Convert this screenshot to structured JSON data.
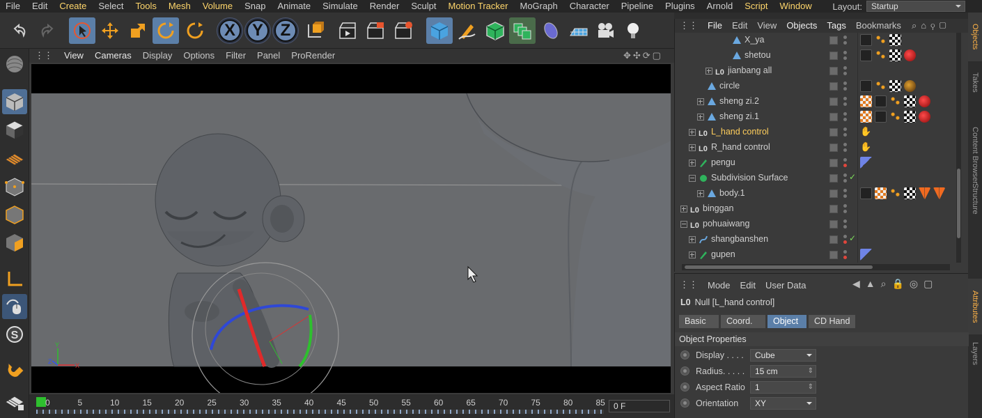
{
  "menubar": {
    "items": [
      "File",
      "Edit",
      "Create",
      "Select",
      "Tools",
      "Mesh",
      "Volume",
      "Snap",
      "Animate",
      "Simulate",
      "Render",
      "Sculpt",
      "Motion Tracker",
      "MoGraph",
      "Character",
      "Pipeline",
      "Plugins",
      "Arnold",
      "Script",
      "Window"
    ],
    "layout_label": "Layout:",
    "layout_value": "Startup"
  },
  "toolbar": {
    "icons": [
      "undo-icon",
      "redo-icon",
      "live-selection-icon",
      "move-icon",
      "scale-icon",
      "rotate-icon",
      "recent-tool-icon",
      "x-axis-icon",
      "y-axis-icon",
      "z-axis-icon",
      "coordinate-system-icon",
      "render-view-icon",
      "render-picture-viewer-icon",
      "render-settings-icon",
      "cube-icon",
      "pen-icon",
      "subdivision-icon",
      "array-icon",
      "deformer-icon",
      "floor-icon",
      "camera-icon",
      "light-icon"
    ],
    "axis_labels": [
      "X",
      "Y",
      "Z"
    ]
  },
  "viewport": {
    "menu": [
      "View",
      "Cameras",
      "Display",
      "Options",
      "Filter",
      "Panel",
      "ProRender"
    ],
    "axis_labels": {
      "x": "X",
      "y": "Y",
      "z": "Z"
    }
  },
  "timeline": {
    "ticks": [
      "0",
      "5",
      "10",
      "15",
      "20",
      "25",
      "30",
      "35",
      "40",
      "45",
      "50",
      "55",
      "60",
      "65",
      "70",
      "75",
      "80",
      "85"
    ],
    "current_frame": "0 F"
  },
  "objects": {
    "menu": [
      "File",
      "Edit",
      "View",
      "Objects",
      "Tags",
      "Bookmarks"
    ],
    "rows": [
      {
        "name": "X_ya",
        "indent": 5,
        "icon": "joint",
        "expander": "none",
        "tags": [
          "dark",
          "dots",
          "checker"
        ]
      },
      {
        "name": "shetou",
        "indent": 5,
        "icon": "joint",
        "expander": "none",
        "tags": [
          "dark",
          "dots",
          "checker",
          "red-ball"
        ]
      },
      {
        "name": "jianbang all",
        "indent": 3,
        "icon": "null",
        "expander": "plus",
        "tags": []
      },
      {
        "name": "circle",
        "indent": 2,
        "icon": "joint",
        "expander": "none",
        "tags": [
          "dark",
          "dots",
          "checker",
          "brown-ball"
        ]
      },
      {
        "name": "sheng zi.2",
        "indent": 2,
        "icon": "joint",
        "expander": "plus",
        "tags": [
          "orange-checker",
          "dark",
          "dots",
          "checker",
          "red-ball"
        ]
      },
      {
        "name": "sheng zi.1",
        "indent": 2,
        "icon": "joint",
        "expander": "plus",
        "tags": [
          "orange-checker",
          "dark",
          "dots",
          "checker",
          "red-ball"
        ]
      },
      {
        "name": "L_hand control",
        "indent": 1,
        "icon": "null",
        "expander": "plus",
        "highlighted": true,
        "tags": [
          "hand"
        ]
      },
      {
        "name": "R_hand control",
        "indent": 1,
        "icon": "null",
        "expander": "plus",
        "tags": [
          "hand"
        ]
      },
      {
        "name": "pengu",
        "indent": 1,
        "icon": "pen",
        "expander": "plus",
        "dotsRed": true,
        "tags": [
          "vertex-map"
        ]
      },
      {
        "name": "Subdivision Surface",
        "indent": 1,
        "icon": "subdiv",
        "expander": "minus",
        "check": true,
        "tags": []
      },
      {
        "name": "body.1",
        "indent": 2,
        "icon": "joint",
        "expander": "plus",
        "tags": [
          "dark",
          "orange-checker",
          "dots",
          "checker",
          "orange-tri",
          "orange-tri"
        ]
      },
      {
        "name": "binggan",
        "indent": 0,
        "icon": "null",
        "expander": "plus",
        "tags": []
      },
      {
        "name": "pohuaiwang",
        "indent": 0,
        "icon": "null",
        "expander": "minus",
        "tags": []
      },
      {
        "name": "shangbanshen",
        "indent": 1,
        "icon": "spline",
        "expander": "plus",
        "dotsRed": true,
        "check": true,
        "tags": []
      },
      {
        "name": "gupen",
        "indent": 1,
        "icon": "pen",
        "expander": "plus",
        "dotsRed": true,
        "tags": [
          "vertex-map"
        ]
      }
    ]
  },
  "sidetabs": [
    "Objects",
    "Takes",
    "Content Browser",
    "Structure",
    "Attributes",
    "Layers"
  ],
  "attributes": {
    "menu": [
      "Mode",
      "Edit",
      "User Data"
    ],
    "title": "Null [L_hand control]",
    "tabs": [
      "Basic",
      "Coord.",
      "Object",
      "CD Hand"
    ],
    "active_tab": "Object",
    "section": "Object Properties",
    "props": [
      {
        "label": "Display . . . .",
        "value": "Cube",
        "kind": "dd"
      },
      {
        "label": "Radius. . . . .",
        "value": "15 cm",
        "kind": "spin"
      },
      {
        "label": "Aspect Ratio",
        "value": "1",
        "kind": "spin"
      },
      {
        "label": "Orientation",
        "value": "XY",
        "kind": "dd"
      }
    ]
  },
  "colors": {
    "accent": "#5b7fa8",
    "highlight_text": "#ffce5c",
    "tab_active": "#ffb347",
    "viewport_bg": "#696b6e"
  }
}
